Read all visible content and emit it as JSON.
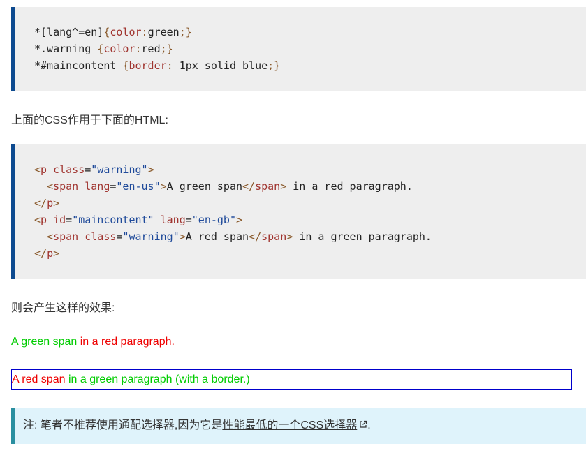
{
  "css_code": {
    "lines": [
      [
        {
          "t": "*[lang^=en]",
          "k": "sel"
        },
        {
          "t": "{",
          "k": "punc"
        },
        {
          "t": "color",
          "k": "prop"
        },
        {
          "t": ":",
          "k": "punc"
        },
        {
          "t": "green",
          "k": "val"
        },
        {
          "t": ";}",
          "k": "punc"
        }
      ],
      [
        {
          "t": "*.warning ",
          "k": "sel"
        },
        {
          "t": "{",
          "k": "punc"
        },
        {
          "t": "color",
          "k": "prop"
        },
        {
          "t": ":",
          "k": "punc"
        },
        {
          "t": "red",
          "k": "val"
        },
        {
          "t": ";}",
          "k": "punc"
        }
      ],
      [
        {
          "t": "*#maincontent ",
          "k": "sel"
        },
        {
          "t": "{",
          "k": "punc"
        },
        {
          "t": "border",
          "k": "prop"
        },
        {
          "t": ": ",
          "k": "punc"
        },
        {
          "t": "1px solid blue",
          "k": "val"
        },
        {
          "t": ";}",
          "k": "punc"
        }
      ]
    ]
  },
  "para_css_applies": "上面的CSS作用于下面的HTML:",
  "html_code": {
    "lines": [
      [
        {
          "t": "<",
          "k": "angle"
        },
        {
          "t": "p",
          "k": "tag"
        },
        {
          "t": " class",
          "k": "attr"
        },
        {
          "t": "=",
          "k": "text"
        },
        {
          "t": "\"warning\"",
          "k": "str"
        },
        {
          "t": ">",
          "k": "angle"
        }
      ],
      [
        {
          "t": "  ",
          "k": "text"
        },
        {
          "t": "<",
          "k": "angle"
        },
        {
          "t": "span",
          "k": "tag"
        },
        {
          "t": " lang",
          "k": "attr"
        },
        {
          "t": "=",
          "k": "text"
        },
        {
          "t": "\"en-us\"",
          "k": "str"
        },
        {
          "t": ">",
          "k": "angle"
        },
        {
          "t": "A green span",
          "k": "text"
        },
        {
          "t": "</",
          "k": "angle"
        },
        {
          "t": "span",
          "k": "tag"
        },
        {
          "t": ">",
          "k": "angle"
        },
        {
          "t": " in a red paragraph.",
          "k": "text"
        }
      ],
      [
        {
          "t": "</",
          "k": "angle"
        },
        {
          "t": "p",
          "k": "tag"
        },
        {
          "t": ">",
          "k": "angle"
        }
      ],
      [
        {
          "t": "<",
          "k": "angle"
        },
        {
          "t": "p",
          "k": "tag"
        },
        {
          "t": " id",
          "k": "attr"
        },
        {
          "t": "=",
          "k": "text"
        },
        {
          "t": "\"maincontent\"",
          "k": "str"
        },
        {
          "t": " lang",
          "k": "attr"
        },
        {
          "t": "=",
          "k": "text"
        },
        {
          "t": "\"en-gb\"",
          "k": "str"
        },
        {
          "t": ">",
          "k": "angle"
        }
      ],
      [
        {
          "t": "  ",
          "k": "text"
        },
        {
          "t": "<",
          "k": "angle"
        },
        {
          "t": "span",
          "k": "tag"
        },
        {
          "t": " class",
          "k": "attr"
        },
        {
          "t": "=",
          "k": "text"
        },
        {
          "t": "\"warning\"",
          "k": "str"
        },
        {
          "t": ">",
          "k": "angle"
        },
        {
          "t": "A red span",
          "k": "text"
        },
        {
          "t": "</",
          "k": "angle"
        },
        {
          "t": "span",
          "k": "tag"
        },
        {
          "t": ">",
          "k": "angle"
        },
        {
          "t": " in a green paragraph.",
          "k": "text"
        }
      ],
      [
        {
          "t": "</",
          "k": "angle"
        },
        {
          "t": "p",
          "k": "tag"
        },
        {
          "t": ">",
          "k": "angle"
        }
      ]
    ]
  },
  "para_effect": "则会产生这样的效果:",
  "demo1": {
    "span_text": "A green span",
    "rest_text": " in a red paragraph."
  },
  "demo2": {
    "span_text": "A red span",
    "rest_text": " in a green paragraph (with a border.)"
  },
  "note": {
    "prefix": "注: 笔者不推荐使用通配选择器,因为它是",
    "link_text": "性能最低的一个CSS选择器",
    "link_icon": "external-link-icon",
    "suffix": "."
  },
  "colors": {
    "demo_green": "#00cc00",
    "demo_red": "#ee0000",
    "demo_border": "#0000cc",
    "code_bg": "#eeeeee",
    "code_border": "#0d4a8f",
    "note_bg": "#dff3fb",
    "note_border": "#2a8fa0"
  }
}
